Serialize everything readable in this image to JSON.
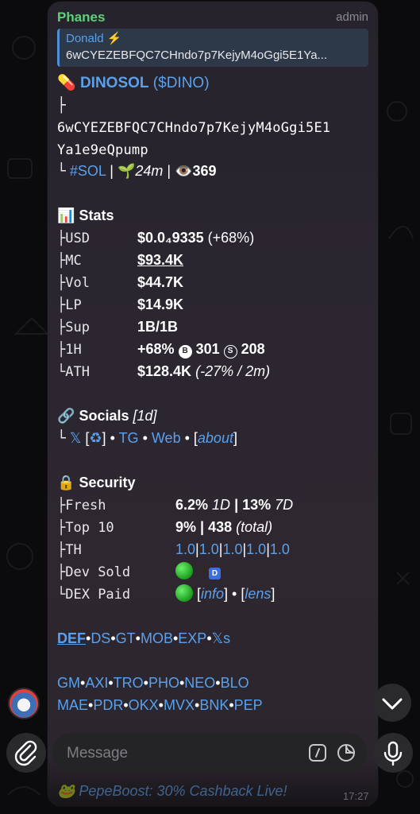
{
  "message": {
    "sender": "Phanes",
    "role": "admin",
    "reply": {
      "name": "Donald ⚡",
      "text": "6wCYEZEBFQC7CHndo7p7KejyM4oGgi5E1Ya..."
    },
    "token": {
      "emoji": "💊",
      "name": "DINOSOL",
      "ticker": "($DINO)",
      "address_line1": "6wCYEZEBFQC7CHndo7p7KejyM4oGgi5E1",
      "address_line2": "Ya1e9eQpump",
      "chain": "#SOL",
      "age": "24m",
      "views": "369"
    },
    "stats": {
      "title": "Stats",
      "rows": [
        {
          "key": "USD",
          "value": "$0.0₄9335",
          "extra": " (+68%)"
        },
        {
          "key": "MC",
          "value": "$93.4K",
          "extra": ""
        },
        {
          "key": "Vol",
          "value": "$44.7K",
          "extra": ""
        },
        {
          "key": "LP",
          "value": "$14.9K",
          "extra": ""
        },
        {
          "key": "Sup",
          "value": "1B/1B",
          "extra": ""
        },
        {
          "key": "1H",
          "value": "+68%",
          "buys": "301",
          "sells": "208"
        },
        {
          "key": "ATH",
          "value": "$128.4K",
          "extra": "(-27% / 2m)"
        }
      ]
    },
    "socials": {
      "title": "Socials",
      "age": "[1d]",
      "links": [
        "𝕏",
        "♻",
        "TG",
        "Web",
        "about"
      ]
    },
    "security": {
      "title": "Security",
      "fresh_pct": "6.2%",
      "fresh_1d": "1D",
      "fresh_7d_pct": "13%",
      "fresh_7d": "7D",
      "top10_pct": "9%",
      "top10_holders": "438",
      "top10_note": "(total)",
      "th_values": [
        "1.0",
        "1.0",
        "1.0",
        "1.0",
        "1.0"
      ],
      "keys": [
        "Fresh",
        "Top 10",
        "TH",
        "Dev Sold",
        "DEX Paid"
      ],
      "dev_badge": "D",
      "dex_links": [
        "info",
        "lens"
      ]
    },
    "bots_row1": [
      "DEF",
      "DS",
      "GT",
      "MOB",
      "EXP",
      "𝕏s"
    ],
    "bots_row2": [
      "GM",
      "AXI",
      "TRO",
      "PHO",
      "NEO",
      "BLO"
    ],
    "bots_row3": [
      "MAE",
      "PDR",
      "OKX",
      "MVX",
      "BNK",
      "PEP"
    ],
    "footer_peek": "🐸 PepeBoost: 30% Cashback Live!",
    "time": "17:27"
  },
  "composer": {
    "placeholder": "Message"
  },
  "colors": {
    "link": "#5aa0ec",
    "sender": "#5fd07a",
    "bubble": "#2a252c",
    "green_dot": "#22b026"
  }
}
